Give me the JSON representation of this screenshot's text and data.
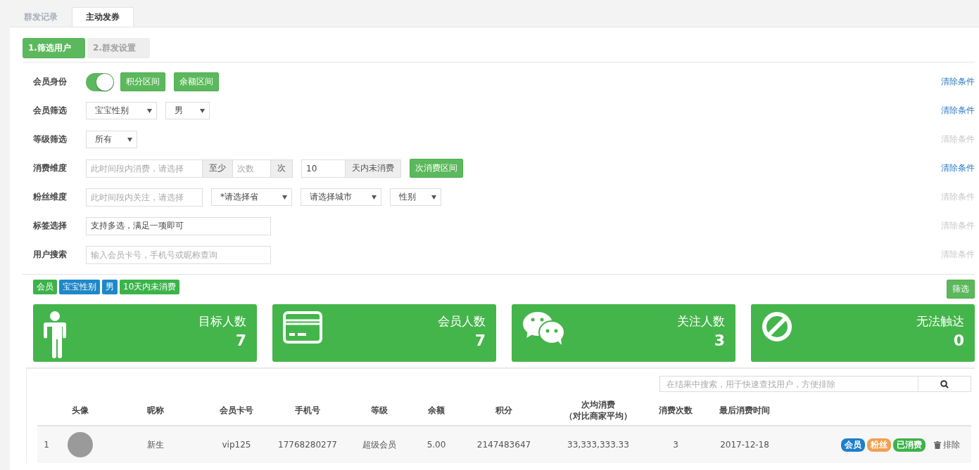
{
  "tabs": [
    {
      "label": "群发记录",
      "selected": false
    },
    {
      "label": "主动发券",
      "selected": true
    }
  ],
  "steps": [
    {
      "label": "1.筛选用户",
      "selected": true
    },
    {
      "label": "2.群发设置",
      "selected": false
    }
  ],
  "filters": [
    {
      "label": "会员身份",
      "clear": {
        "text": "清除条件",
        "disabled": false
      },
      "controls": [
        {
          "kind": "toggle",
          "on": true
        },
        {
          "kind": "button",
          "text": "积分区间"
        },
        {
          "kind": "button",
          "text": "余额区间"
        }
      ]
    },
    {
      "label": "会员筛选",
      "clear": {
        "text": "清除条件",
        "disabled": false
      },
      "controls": [
        {
          "kind": "select",
          "value": "宝宝性别"
        },
        {
          "kind": "select",
          "value": "男"
        }
      ]
    },
    {
      "label": "等级筛选",
      "clear": {
        "text": "清除条件",
        "disabled": true
      },
      "controls": [
        {
          "kind": "select",
          "value": "所有"
        }
      ]
    },
    {
      "label": "消费维度",
      "clear": {
        "text": "清除条件",
        "disabled": false
      },
      "controls": [
        {
          "kind": "group",
          "parts": [
            {
              "kind": "date",
              "placeholder": "此时间段内消费，请选择"
            },
            {
              "kind": "addon",
              "text": "至少"
            },
            {
              "kind": "input",
              "placeholder": "次数"
            },
            {
              "kind": "addon",
              "text": "次"
            }
          ]
        },
        {
          "kind": "group",
          "parts": [
            {
              "kind": "input",
              "value": "10"
            },
            {
              "kind": "addon",
              "text": "天内未消费"
            }
          ]
        },
        {
          "kind": "button",
          "text": "次消费区间"
        }
      ]
    },
    {
      "label": "粉丝维度",
      "clear": {
        "text": "清除条件",
        "disabled": true
      },
      "controls": [
        {
          "kind": "date",
          "placeholder": "此时间段内关注，请选择"
        },
        {
          "kind": "select",
          "value": "*请选择省"
        },
        {
          "kind": "select",
          "value": "请选择城市"
        },
        {
          "kind": "select",
          "value": "性别"
        }
      ]
    },
    {
      "label": "标签选择",
      "clear": {
        "text": "清除条件",
        "disabled": true
      },
      "controls": [
        {
          "kind": "wide",
          "value": "支持多选，满足一项即可"
        }
      ]
    },
    {
      "label": "用户搜索",
      "clear": {
        "text": "清除条件",
        "disabled": true
      },
      "controls": [
        {
          "kind": "wide",
          "placeholder": "输入会员卡号，手机号或昵称查询"
        }
      ]
    }
  ],
  "tags": [
    {
      "text": "会员",
      "color": "#3cb34a"
    },
    {
      "text": "宝宝性别",
      "color": "#1e88c9"
    },
    {
      "text": "男",
      "color": "#1e88c9"
    },
    {
      "text": "10天内未消费",
      "color": "#3cb34a"
    }
  ],
  "filter_button": "筛选",
  "cards": [
    {
      "kind": "person",
      "title": "目标人数",
      "value": "7"
    },
    {
      "kind": "card",
      "title": "会员人数",
      "value": "7"
    },
    {
      "kind": "chat",
      "title": "关注人数",
      "value": "3"
    },
    {
      "kind": "ban",
      "title": "无法触达",
      "value": "0"
    }
  ],
  "search": {
    "placeholder": "在结果中搜索，用于快速查找用户，方便排除"
  },
  "table": {
    "columns": [
      {},
      {
        "label": "头像"
      },
      {
        "label": "昵称"
      },
      {
        "label": "会员卡号"
      },
      {
        "label": "手机号"
      },
      {
        "label": "等级"
      },
      {
        "label": "余额"
      },
      {
        "label": "积分"
      },
      {
        "label": "次均消费",
        "sub": "（对比商家平均）"
      },
      {
        "label": "消费次数"
      },
      {
        "label": "最后消费时间"
      },
      {}
    ],
    "rows": [
      {
        "index": "1",
        "nickname": "新生",
        "card": "vip125",
        "phone": "17768280277",
        "level": "超级会员",
        "balance": "5.00",
        "points": "2147483647",
        "avg": "33,333,333.33",
        "count": "3",
        "last": "2017-12-18",
        "badges": [
          {
            "text": "会员",
            "color": "#1e7fcb"
          },
          {
            "text": "粉丝",
            "color": "#f0a050"
          },
          {
            "text": "已消费",
            "color": "#3cb34a"
          }
        ],
        "action": "排除"
      }
    ]
  }
}
